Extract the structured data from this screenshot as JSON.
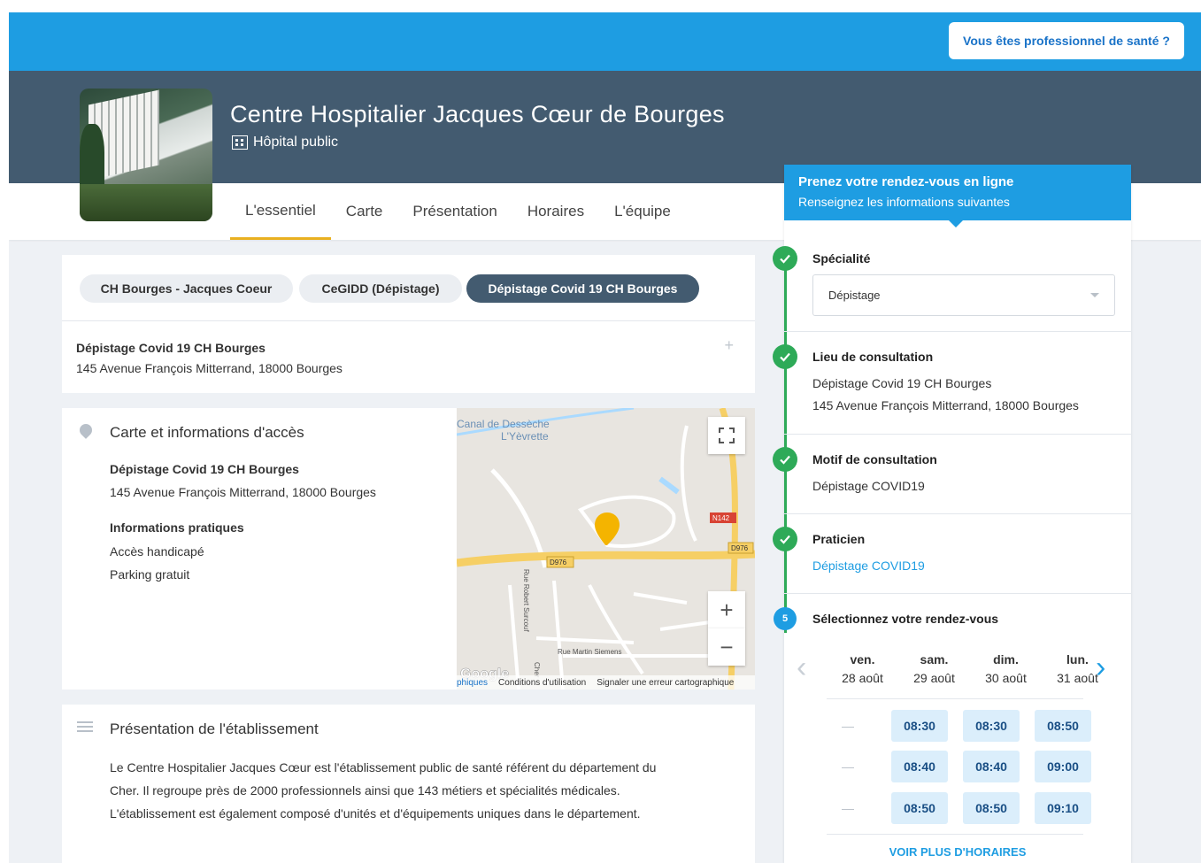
{
  "header": {
    "pro_button": "Vous êtes professionnel de santé ?"
  },
  "hero": {
    "title": "Centre Hospitalier Jacques Cœur de Bourges",
    "subtitle": "Hôpital public"
  },
  "nav": {
    "tabs": [
      {
        "label": "L'essentiel"
      },
      {
        "label": "Carte"
      },
      {
        "label": "Présentation"
      },
      {
        "label": "Horaires"
      },
      {
        "label": "L'équipe"
      }
    ],
    "active": "L'essentiel"
  },
  "locations": {
    "chips": [
      {
        "label": "CH Bourges - Jacques Coeur"
      },
      {
        "label": "CeGIDD (Dépistage)"
      },
      {
        "label": "Dépistage Covid 19 CH Bourges"
      }
    ],
    "selected_name": "Dépistage Covid 19 CH Bourges",
    "selected_address": "145 Avenue François Mitterrand, 18000 Bourges",
    "expand_icon": "+"
  },
  "access": {
    "title": "Carte et informations d'accès",
    "name": "Dépistage Covid 19 CH Bourges",
    "address": "145 Avenue François Mitterrand, 18000 Bourges",
    "info_title": "Informations pratiques",
    "info_items": [
      "Accès handicapé",
      "Parking gratuit"
    ]
  },
  "map": {
    "labels": {
      "canal": "Canal de Dessèche",
      "river": "L'Yèvrette",
      "road1": "N142",
      "road2": "D976",
      "road3": "D976",
      "street1": "Rue Robert Surcouf",
      "street2": "Rue Martin Siemens",
      "street3": "Cher",
      "google": "Google"
    },
    "footer": {
      "shortcuts": "phiques",
      "terms": "Conditions d'utilisation",
      "report": "Signaler une erreur cartographique"
    },
    "zoom_in": "+",
    "zoom_out": "−"
  },
  "presentation": {
    "title": "Présentation de l'établissement",
    "text_lines": [
      "Le Centre Hospitalier Jacques Cœur est l'établissement public de santé référent du département du",
      "Cher. Il regroupe près de 2000 professionnels ainsi que 143 métiers et spécialités médicales.",
      "L'établissement est également composé d'unités et d'équipements uniques dans le département."
    ]
  },
  "booking": {
    "title": "Prenez votre rendez-vous en ligne",
    "subtitle": "Renseignez les informations suivantes",
    "steps": {
      "specialty": {
        "label": "Spécialité",
        "value": "Dépistage"
      },
      "location": {
        "label": "Lieu de consultation",
        "line1": "Dépistage Covid 19 CH Bourges",
        "line2": "145 Avenue François Mitterrand, 18000 Bourges"
      },
      "reason": {
        "label": "Motif de consultation",
        "value": "Dépistage COVID19"
      },
      "practitioner": {
        "label": "Praticien",
        "value": "Dépistage COVID19"
      },
      "select": {
        "number": "5",
        "label": "Sélectionnez votre rendez-vous"
      }
    },
    "days": [
      {
        "name": "ven.",
        "date": "28 août"
      },
      {
        "name": "sam.",
        "date": "29 août"
      },
      {
        "name": "dim.",
        "date": "30 août"
      },
      {
        "name": "lun.",
        "date": "31 août"
      }
    ],
    "slots": [
      [
        "—",
        "08:30",
        "08:30",
        "08:50"
      ],
      [
        "—",
        "08:40",
        "08:40",
        "09:00"
      ],
      [
        "—",
        "08:50",
        "08:50",
        "09:10"
      ]
    ],
    "more_label": "VOIR PLUS D'HORAIRES"
  },
  "colors": {
    "brand_blue": "#1e9de2",
    "header_slate": "#435b70",
    "accent_yellow": "#e9b020",
    "check_green": "#2eaa58"
  }
}
